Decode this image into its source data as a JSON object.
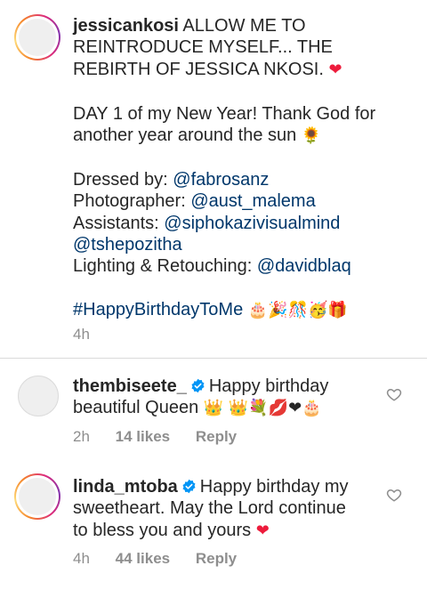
{
  "caption": {
    "username": "jessicankosi",
    "lines": [
      "ALLOW ME TO",
      "REINTRODUCE MYSELF... THE",
      "REBIRTH OF JESSICA NKOSI.",
      "DAY 1 of my New Year! Thank God for",
      "another year around the sun"
    ],
    "dressed_by_label": "Dressed by:",
    "dressed_by": "@fabrosanz",
    "photographer_label": "Photographer:",
    "photographer": "@aust_malema",
    "assistants_label": "Assistants:",
    "assistant_1": "@siphokazivisualmind",
    "assistant_2": "@tshepozitha",
    "lighting_label": "Lighting & Retouching:",
    "lighting": "@davidblaq",
    "hashtag": "#HappyBirthdayToMe",
    "emojis_hashtag": "🎂🎉🎊🥳🎁",
    "emoji_heart": "❤",
    "emoji_sunflower": "🌻",
    "time": "4h"
  },
  "comments": [
    {
      "username": "thembiseete_",
      "text_line1": "Happy birthday",
      "text_line2": "beautiful Queen",
      "emojis": "👑 👑💐💋❤🎂",
      "time": "2h",
      "likes": "14 likes",
      "reply": "Reply"
    },
    {
      "username": "linda_mtoba",
      "text_line1": "Happy birthday my",
      "text_line2": "sweetheart. May the Lord continue",
      "text_line3": "to bless you and yours",
      "emoji": "❤",
      "time": "4h",
      "likes": "44 likes",
      "reply": "Reply"
    }
  ],
  "colors": {
    "text": "#262626",
    "link": "#00376b",
    "meta": "#8e8e8e",
    "verified": "#0095f6",
    "heart": "#ed1c3c"
  },
  "icons": {
    "verified": "verified-badge-icon",
    "like": "heart-outline-icon"
  }
}
